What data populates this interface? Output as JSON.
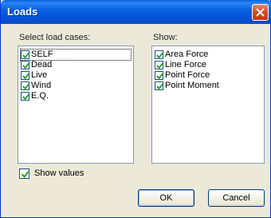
{
  "window": {
    "title": "Loads"
  },
  "load_cases": {
    "label": "Select load cases:",
    "items": [
      {
        "label": "SELF",
        "checked": true
      },
      {
        "label": "Dead",
        "checked": true
      },
      {
        "label": "Live",
        "checked": true
      },
      {
        "label": "Wind",
        "checked": true
      },
      {
        "label": "E.Q.",
        "checked": true
      }
    ]
  },
  "show": {
    "label": "Show:",
    "items": [
      {
        "label": "Area Force",
        "checked": true
      },
      {
        "label": "Line Force",
        "checked": true
      },
      {
        "label": "Point Force",
        "checked": true
      },
      {
        "label": "Point Moment",
        "checked": true
      }
    ]
  },
  "show_values": {
    "label": "Show values",
    "checked": true
  },
  "buttons": {
    "ok": "OK",
    "cancel": "Cancel"
  }
}
